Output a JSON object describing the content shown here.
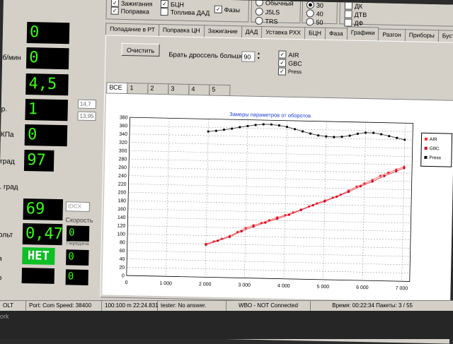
{
  "top_checks": {
    "zazhiganie": "Зажигания",
    "popravka": "Поправка",
    "bcn": "БЦН",
    "toplivo": "Топлива ДАД",
    "fazy": "Фазы",
    "mode_top": "Обычный",
    "j5ls": "J5LS",
    "trs": "TRS",
    "r30": "30",
    "r40": "40",
    "r50": "50",
    "dk": "ДК",
    "dtv": "ДТВ",
    "df": "ДФ"
  },
  "left": {
    "labels": {
      "l1": "б/мин",
      "l2": "р.",
      "l3": "КПа",
      "l4": "град",
      "l5": ". град",
      "l6": "ольт",
      "l7": "Скорость",
      "l8": "Передача",
      "l9": "я",
      "l10": "р"
    },
    "values": {
      "v1": "0",
      "v2": "0",
      "v3": "4,5",
      "v4": "1",
      "v5": "0",
      "v6": "97",
      "v7": "69",
      "v8": "0,47",
      "v9": "НЕТ",
      "v10": "0",
      "v11": "0",
      "v12": "0"
    },
    "afr1": "14,7",
    "afr2": "13,95",
    "idx": "IDCX"
  },
  "tabs": [
    "Попадание в РТ",
    "Поправка ЦН",
    "Зажигание",
    "ДАД",
    "Уставка РХХ",
    "БЦН",
    "Фаза",
    "Графики",
    "Разгон",
    "Приборы",
    "БустКонтроль"
  ],
  "controls": {
    "clear_button": "Очистить",
    "throttle_label": "Брать дроссель больше",
    "throttle_value": "90",
    "chk_air": "AIR",
    "chk_gbc": "GBC",
    "chk_press": "Press"
  },
  "subtabs": [
    "ВСЕ",
    "1",
    "2",
    "3",
    "4",
    "5"
  ],
  "chart_data": {
    "type": "scatter",
    "title": "Замеры параметров от оборотов",
    "xlim": [
      0,
      7200
    ],
    "ylim": [
      0,
      380
    ],
    "x_ticks": [
      "0",
      "1 000",
      "2 000",
      "3 000",
      "4 000",
      "5 000",
      "6 000",
      "7 000"
    ],
    "y_ticks": [
      "0",
      "20",
      "40",
      "60",
      "80",
      "100",
      "120",
      "140",
      "160",
      "180",
      "200",
      "220",
      "240",
      "260",
      "280",
      "300",
      "320",
      "340",
      "360",
      "380"
    ],
    "legend": [
      "AIR",
      "GBC",
      "Press"
    ],
    "legend_position": "right",
    "grid": true,
    "series": [
      {
        "name": "AIR",
        "color": "#ff2a2a",
        "x": [
          2000,
          2200,
          2400,
          2600,
          2800,
          3000,
          3200,
          3400,
          3600,
          3800,
          4000,
          4200,
          4400,
          4600,
          4800,
          5000,
          5200,
          5400,
          5600,
          5800,
          6000,
          6200,
          6400,
          6600,
          6800,
          7000
        ],
        "y": [
          80,
          86,
          93,
          100,
          110,
          120,
          127,
          133,
          140,
          147,
          153,
          160,
          167,
          175,
          183,
          190,
          197,
          205,
          215,
          225,
          233,
          242,
          252,
          260,
          268,
          275
        ]
      },
      {
        "name": "GBC",
        "color": "#c8001e",
        "x": [
          2000,
          2300,
          2600,
          2900,
          3200,
          3500,
          3800,
          4100,
          4400,
          4700,
          5000,
          5300,
          5600,
          5900,
          6200,
          6500,
          6800,
          7000
        ],
        "y": [
          78,
          88,
          98,
          112,
          124,
          134,
          144,
          154,
          166,
          178,
          188,
          200,
          212,
          226,
          238,
          252,
          264,
          272
        ]
      },
      {
        "name": "Press",
        "color": "#000000",
        "x": [
          2000,
          2200,
          2400,
          2600,
          2800,
          3000,
          3200,
          3400,
          3600,
          3800,
          4000,
          4200,
          4400,
          4600,
          4800,
          5000,
          5200,
          5400,
          5600,
          5800,
          6000,
          6200,
          6400,
          6600,
          6800,
          7000
        ],
        "y": [
          350,
          352,
          355,
          358,
          362,
          365,
          368,
          370,
          370,
          368,
          365,
          360,
          355,
          350,
          346,
          344,
          343,
          344,
          347,
          352,
          355,
          355,
          352,
          348,
          344,
          340
        ]
      }
    ]
  },
  "status": {
    "s1": "OLT",
    "s2": "Port: Com  Speed: 38400",
    "s3": "100:100 m  22:24.831",
    "s4": "tester: No answer.",
    "s5": "WBO - NOT Connected",
    "s6": "Время: 00:22:34   Пакеты: 3 / 55",
    "dark_text": "ork"
  }
}
